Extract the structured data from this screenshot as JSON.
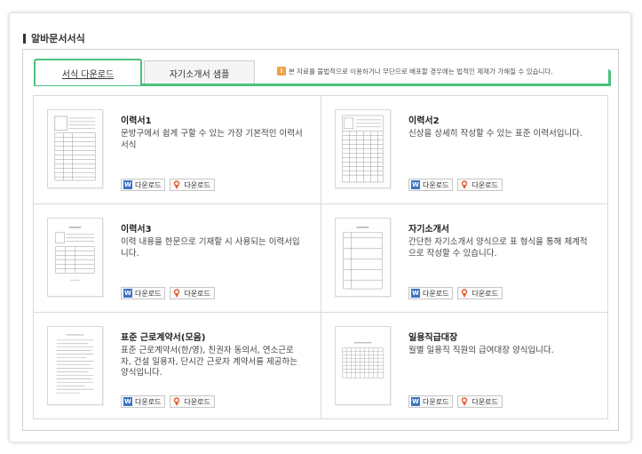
{
  "section": {
    "title": "알바문서서식"
  },
  "tabs": [
    {
      "label": "서식 다운로드",
      "active": true
    },
    {
      "label": "자기소개서 샘플",
      "active": false
    }
  ],
  "notice": {
    "icon": "warning-icon",
    "text": "본 자료를 불법적으로 이용하거나 무단으로 배포할 경우에는 법적인 제재가 가해질 수 있습니다."
  },
  "buttons": {
    "word_label": "다운로드",
    "hwp_label": "다운로드"
  },
  "cards": [
    {
      "title": "이력서1",
      "desc": "문방구에서 쉽게 구할 수 있는 가장 기본적인 이력서 서식"
    },
    {
      "title": "이력서2",
      "desc": "신상을 상세히 작성할 수 있는 표준 이력서입니다."
    },
    {
      "title": "이력서3",
      "desc": "이력 내용을 한문으로 기재할 시 사용되는 이력서입니다."
    },
    {
      "title": "자기소개서",
      "desc": "간단한 자기소개서 양식으로 표 형식을 통해 체계적으로 작성할 수 있습니다."
    },
    {
      "title": "표준 근로계약서(모음)",
      "desc": "표준 근로계약서(한/영), 친권자 동의서, 연소근로자, 건설 일용자, 단시간 근로자 계약서를 제공하는 양식입니다."
    },
    {
      "title": "일용직급대장",
      "desc": "월별 일용직 직원의 급여대장 양식입니다."
    }
  ],
  "colors": {
    "accent": "#4cc07d",
    "word_icon": "#3c73c4",
    "hwp_icon": "#e05a2b",
    "warning": "#f0a24a"
  }
}
